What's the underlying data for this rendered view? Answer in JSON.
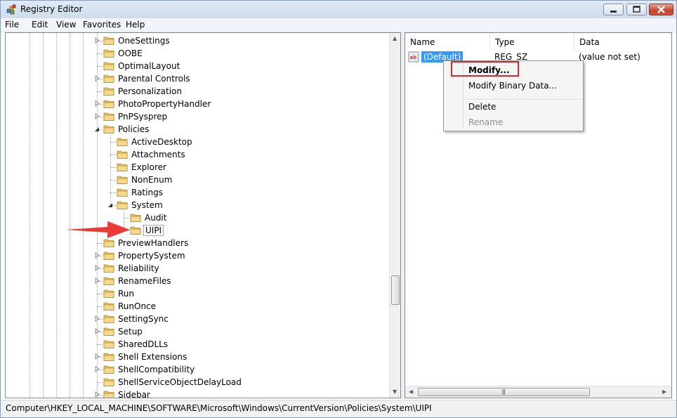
{
  "window": {
    "title": "Registry Editor"
  },
  "menu": [
    "File",
    "Edit",
    "View",
    "Favorites",
    "Help"
  ],
  "tree": {
    "items": [
      {
        "label": "OneSettings",
        "level": 0,
        "expander": "collapsed"
      },
      {
        "label": "OOBE",
        "level": 0,
        "expander": "none"
      },
      {
        "label": "OptimalLayout",
        "level": 0,
        "expander": "none"
      },
      {
        "label": "Parental Controls",
        "level": 0,
        "expander": "collapsed"
      },
      {
        "label": "Personalization",
        "level": 0,
        "expander": "none"
      },
      {
        "label": "PhotoPropertyHandler",
        "level": 0,
        "expander": "collapsed"
      },
      {
        "label": "PnPSysprep",
        "level": 0,
        "expander": "collapsed"
      },
      {
        "label": "Policies",
        "level": 0,
        "expander": "expanded"
      },
      {
        "label": "ActiveDesktop",
        "level": 1,
        "expander": "none"
      },
      {
        "label": "Attachments",
        "level": 1,
        "expander": "none"
      },
      {
        "label": "Explorer",
        "level": 1,
        "expander": "none"
      },
      {
        "label": "NonEnum",
        "level": 1,
        "expander": "none"
      },
      {
        "label": "Ratings",
        "level": 1,
        "expander": "none"
      },
      {
        "label": "System",
        "level": 1,
        "expander": "expanded"
      },
      {
        "label": "Audit",
        "level": 2,
        "expander": "none"
      },
      {
        "label": "UIPI",
        "level": 2,
        "expander": "none",
        "selected": true
      },
      {
        "label": "PreviewHandlers",
        "level": 0,
        "expander": "none"
      },
      {
        "label": "PropertySystem",
        "level": 0,
        "expander": "collapsed"
      },
      {
        "label": "Reliability",
        "level": 0,
        "expander": "collapsed"
      },
      {
        "label": "RenameFiles",
        "level": 0,
        "expander": "collapsed"
      },
      {
        "label": "Run",
        "level": 0,
        "expander": "none"
      },
      {
        "label": "RunOnce",
        "level": 0,
        "expander": "none"
      },
      {
        "label": "SettingSync",
        "level": 0,
        "expander": "collapsed"
      },
      {
        "label": "Setup",
        "level": 0,
        "expander": "collapsed"
      },
      {
        "label": "SharedDLLs",
        "level": 0,
        "expander": "none"
      },
      {
        "label": "Shell Extensions",
        "level": 0,
        "expander": "collapsed"
      },
      {
        "label": "ShellCompatibility",
        "level": 0,
        "expander": "collapsed"
      },
      {
        "label": "ShellServiceObjectDelayLoad",
        "level": 0,
        "expander": "none"
      },
      {
        "label": "Sidebar",
        "level": 0,
        "expander": "collapsed"
      }
    ]
  },
  "list": {
    "columns": [
      "Name",
      "Type",
      "Data"
    ],
    "rows": [
      {
        "name": "(Default)",
        "type": "REG_SZ",
        "data": "(value not set)"
      }
    ]
  },
  "context_menu": {
    "items": [
      {
        "label": "Modify...",
        "bold": true,
        "disabled": false
      },
      {
        "label": "Modify Binary Data...",
        "bold": false,
        "disabled": false
      },
      {
        "label": "Delete",
        "bold": false,
        "disabled": false
      },
      {
        "label": "Rename",
        "bold": false,
        "disabled": true
      }
    ]
  },
  "status": {
    "path": "Computer\\HKEY_LOCAL_MACHINE\\SOFTWARE\\Microsoft\\Windows\\CurrentVersion\\Policies\\System\\UIPI"
  },
  "colors": {
    "selection": "#3399ff",
    "highlight_box": "#e0252b",
    "arrow": "#ee3a36"
  },
  "icons": {
    "app": "registry-editor-icon",
    "folder": "folder-icon",
    "value": "string-value-icon"
  }
}
